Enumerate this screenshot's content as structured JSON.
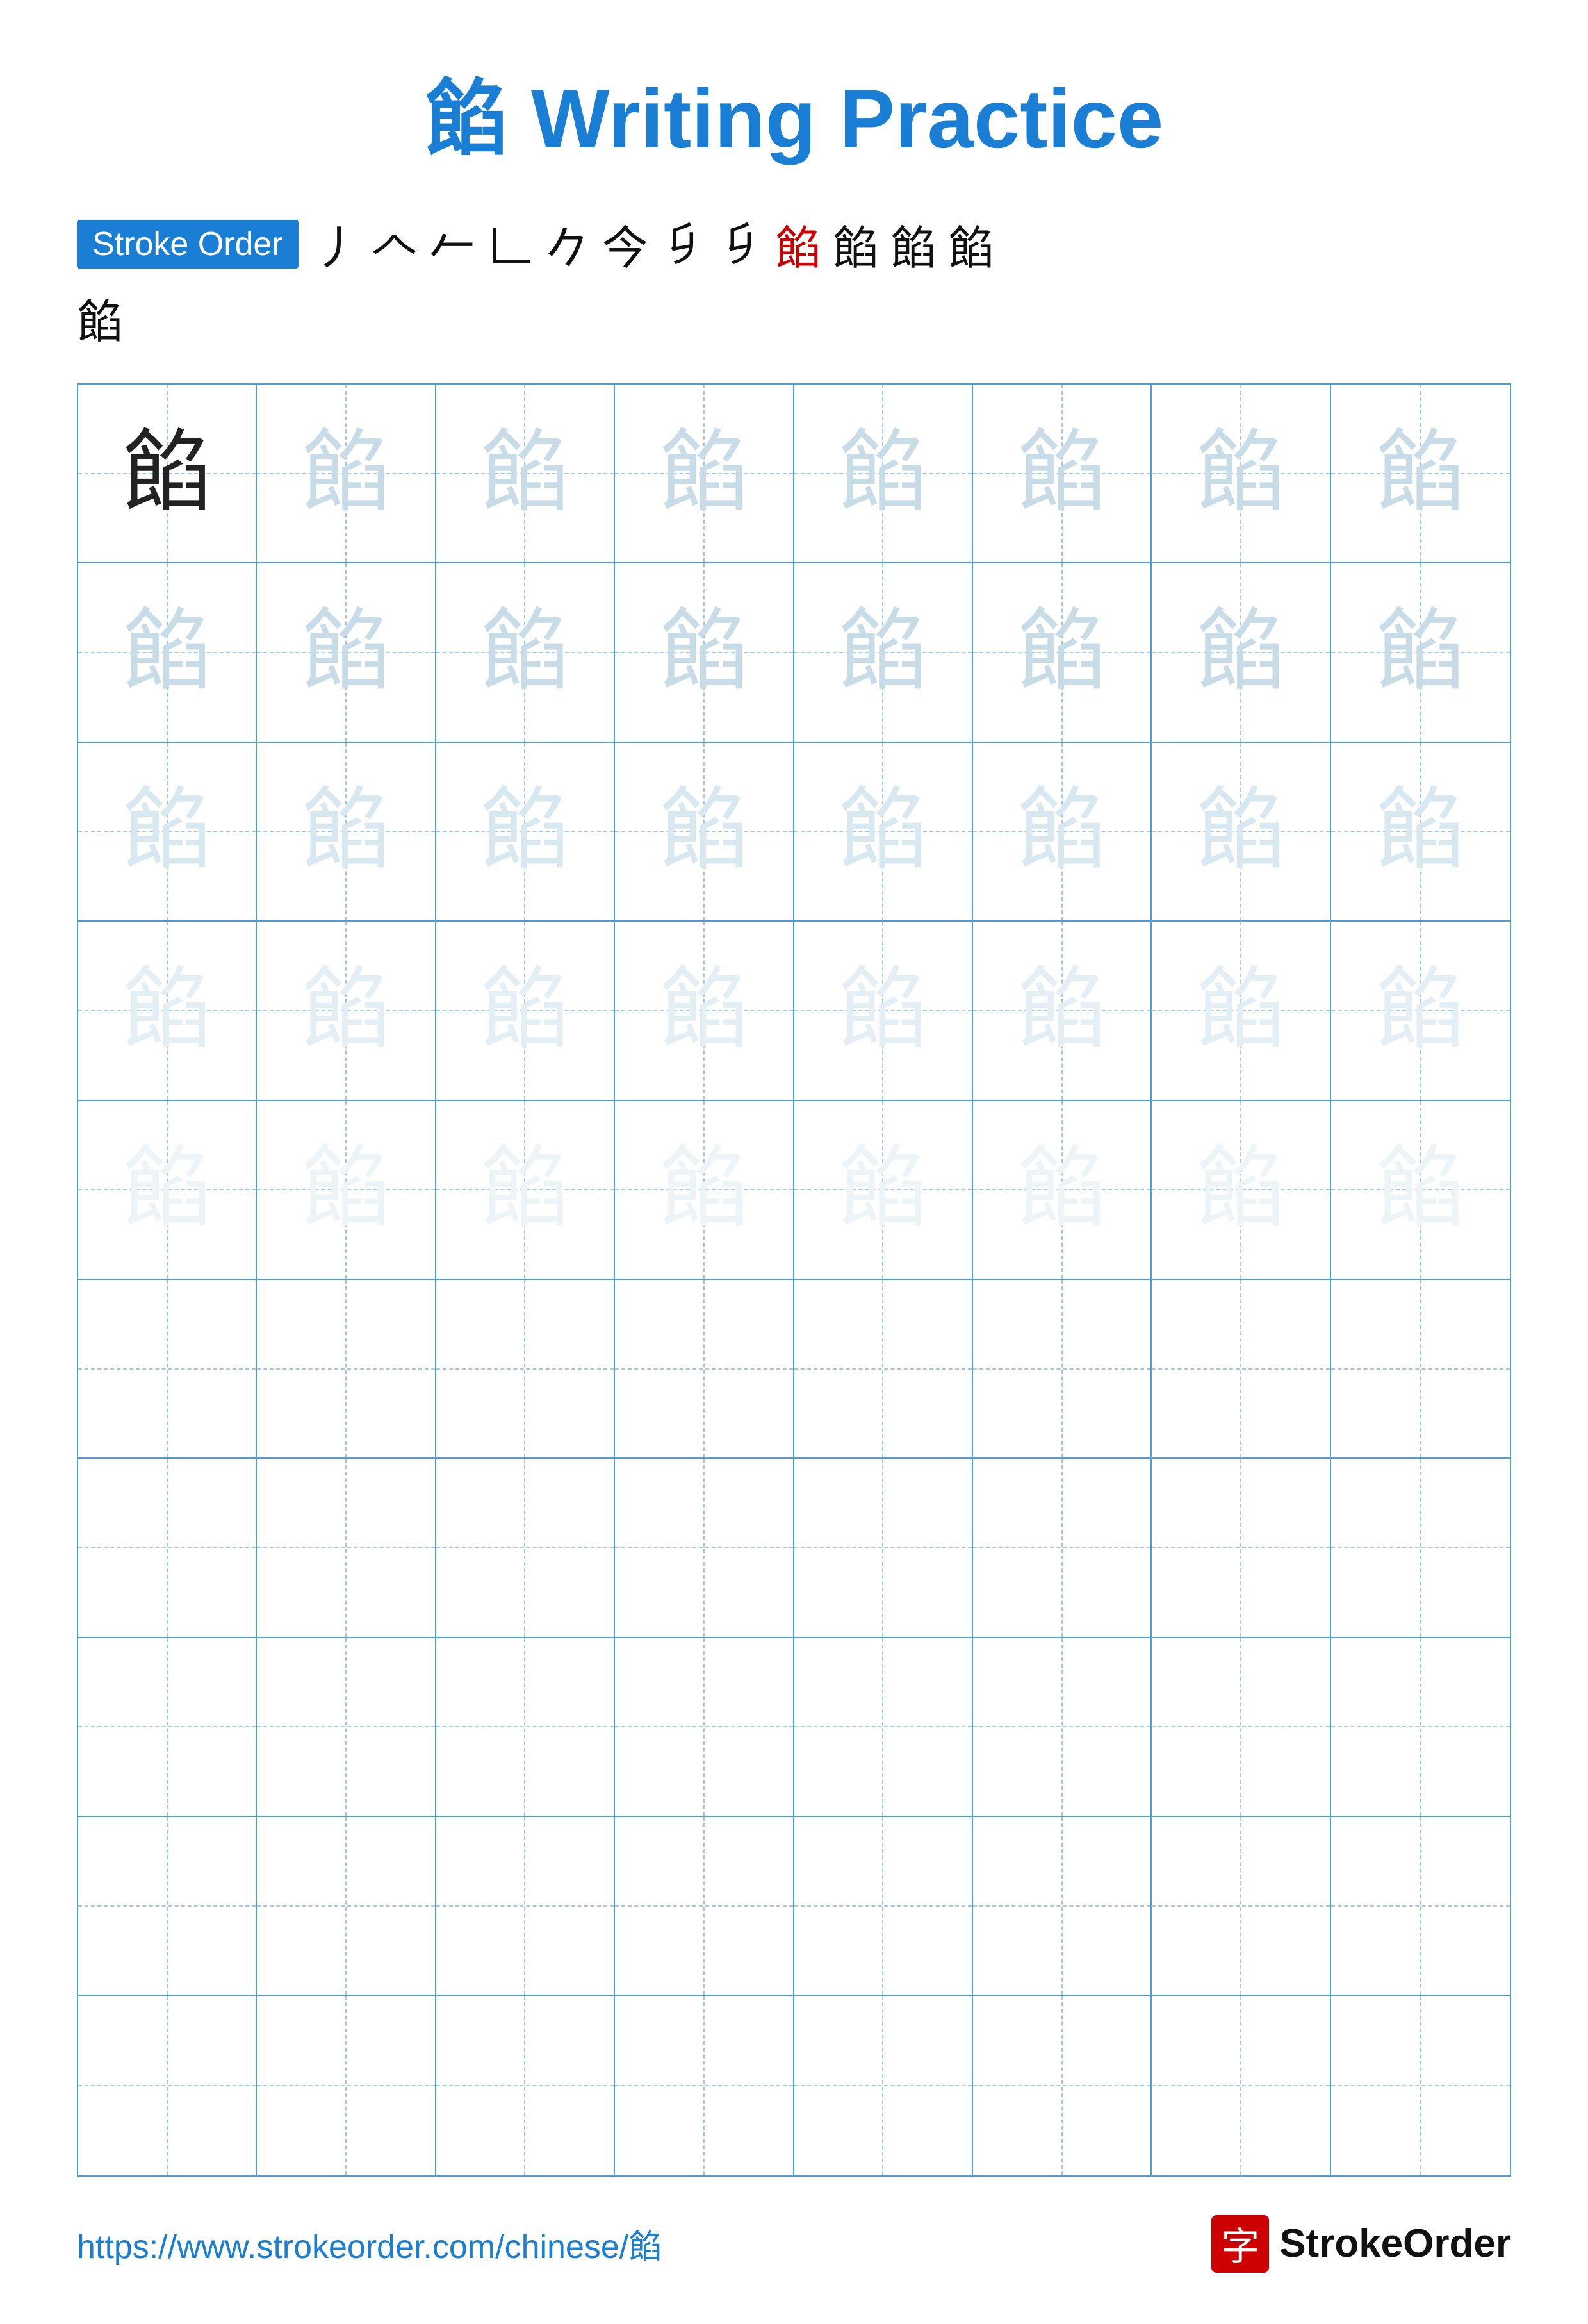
{
  "title": "餡 Writing Practice",
  "stroke_order": {
    "badge_label": "Stroke Order",
    "strokes": [
      "丿",
      "𠆢",
      "𠃊",
      "今",
      "今",
      "今",
      "𠂎",
      "𠂎",
      "餡",
      "餡",
      "餡",
      "餡"
    ],
    "stroke_sequence": [
      "丿",
      "𠆢",
      "𠃊",
      "今",
      "今",
      "今",
      "𠂎",
      "𠂎"
    ],
    "red_index": 8,
    "final_char": "餡"
  },
  "character": "餡",
  "grid": {
    "rows": 10,
    "cols": 8,
    "filled_rows": 5,
    "char_dark": "餡",
    "char_light": "餡"
  },
  "footer": {
    "url": "https://www.strokeorder.com/chinese/餡",
    "logo_text": "StrokeOrder",
    "logo_icon": "字"
  }
}
